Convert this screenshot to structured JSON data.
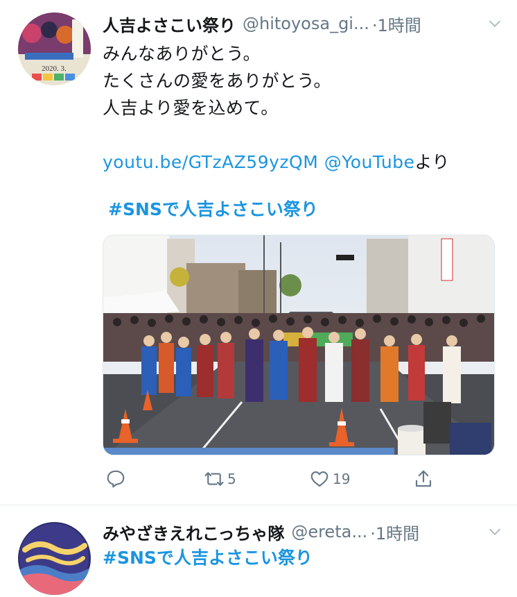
{
  "tweets": [
    {
      "author": {
        "name": "人吉よさこい祭り",
        "handle": "@hitoyosa_gi...",
        "time": "1時間"
      },
      "lines": [
        "みんなありがとう。",
        "たくさんの愛をありがとう。",
        "人吉より愛を込めて。"
      ],
      "link": {
        "url": "youtu.be/GTzAZ59yzQM",
        "mention": "@YouTube",
        "suffix": "より"
      },
      "hashtag": "#SNSで人吉よさこい祭り",
      "avatar_text": "2020. 3.",
      "actions": {
        "reply_count": "",
        "retweet_count": "5",
        "like_count": "19"
      }
    },
    {
      "author": {
        "name": "みやざきえれこっちゃ隊",
        "handle": "@ereta...",
        "time": "1時間"
      },
      "hashtag": "#SNSで人吉よさこい祭り"
    }
  ],
  "colors": {
    "link": "#1b95e0",
    "secondary": "#657786",
    "text": "#14171a",
    "divider": "#e6ecf0"
  },
  "icons": [
    "chevron-down-icon",
    "reply-icon",
    "retweet-icon",
    "like-icon",
    "share-icon"
  ]
}
